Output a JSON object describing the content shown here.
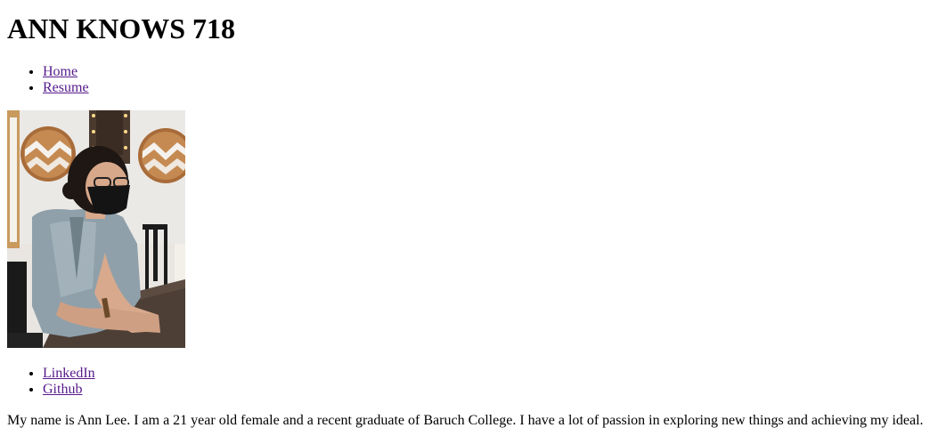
{
  "header": {
    "title": "ANN KNOWS 718"
  },
  "nav": {
    "items": [
      {
        "label": "Home"
      },
      {
        "label": "Resume"
      }
    ]
  },
  "profile_photo": {
    "alt": "Photo of Ann Lee"
  },
  "social": {
    "items": [
      {
        "label": "LinkedIn"
      },
      {
        "label": "Github"
      }
    ]
  },
  "bio": {
    "text": "My name is Ann Lee. I am a 21 year old female and a recent graduate of Baruch College. I have a lot of passion in exploring new things and achieving my ideal."
  },
  "colors": {
    "link": "#551a8b",
    "text": "#000000",
    "background": "#ffffff"
  }
}
